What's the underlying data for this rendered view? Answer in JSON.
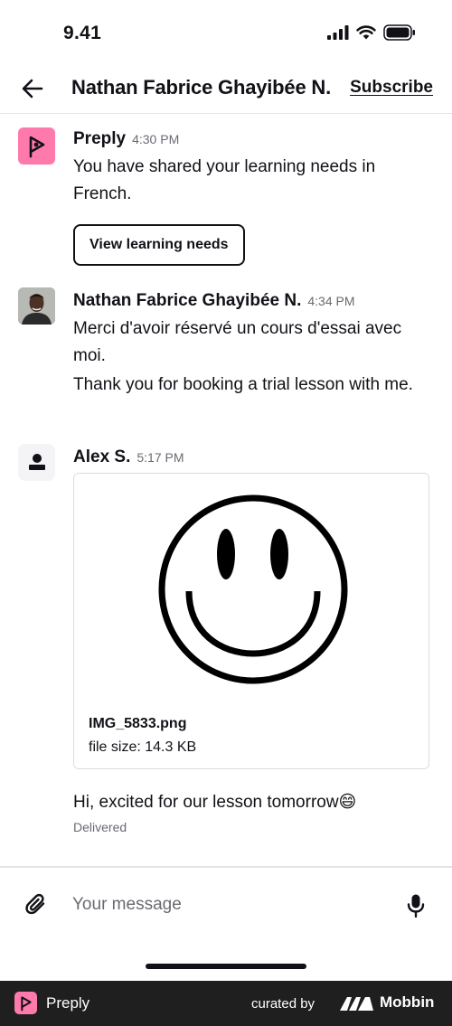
{
  "status_bar": {
    "time": "9.41"
  },
  "header": {
    "title": "Nathan Fabrice Ghayibée N.",
    "subscribe_label": "Subscribe"
  },
  "messages": [
    {
      "sender": "Preply",
      "time": "4:30 PM",
      "text": "You have shared your learning needs in French.",
      "button_label": "View learning needs"
    },
    {
      "sender": "Nathan Fabrice Ghayibée N.",
      "time": "4:34 PM",
      "text_fr": "Merci d'avoir réservé un cours d'essai avec moi.",
      "text_en": "Thank you for booking a trial lesson with me."
    },
    {
      "sender": "Alex S.",
      "time": "5:17 PM",
      "attachment": {
        "filename": "IMG_5833.png",
        "size": "file size: 14.3 KB"
      },
      "text": "Hi, excited for our lesson tomorrow😄",
      "status": "Delivered"
    }
  ],
  "composer": {
    "placeholder": "Your message"
  },
  "footer": {
    "brand": "Preply",
    "curated_by": "curated by",
    "mobbin": "Mobbin"
  },
  "icons": [
    "back-arrow-icon",
    "paperclip-icon",
    "microphone-icon",
    "signal-icon",
    "wifi-icon",
    "battery-icon"
  ],
  "colors": {
    "preply_pink": "#ff7aac",
    "text": "#121117",
    "muted": "#6a6a72",
    "footer_bg": "#1f1f1f"
  }
}
